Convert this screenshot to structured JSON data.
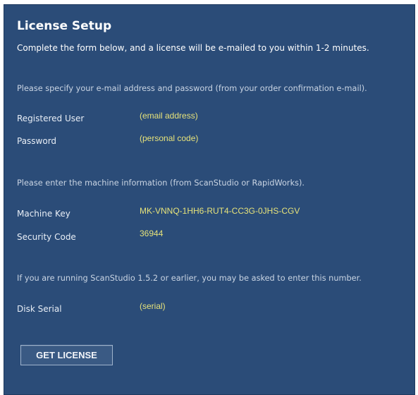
{
  "header": {
    "title": "License Setup",
    "subtitle": "Complete the form below, and a license will be e-mailed to you within 1-2 minutes."
  },
  "account_section": {
    "note": "Please specify your e-mail address and password (from your order confirmation e-mail).",
    "registered_user_label": "Registered User",
    "registered_user_value": "(email address)",
    "password_label": "Password",
    "password_value": "(personal code)"
  },
  "machine_section": {
    "note": "Please enter the machine information (from ScanStudio or RapidWorks).",
    "machine_key_label": "Machine Key",
    "machine_key_value": "MK-VNNQ-1HH6-RUT4-CC3G-0JHS-CGV",
    "security_code_label": "Security Code",
    "security_code_value": "36944"
  },
  "disk_section": {
    "note": "If you are running ScanStudio 1.5.2 or earlier, you may be asked to enter this number.",
    "disk_serial_label": "Disk Serial",
    "disk_serial_value": "(serial)"
  },
  "actions": {
    "get_license_label": "GET LICENSE"
  },
  "colors": {
    "panel_background": "#2b4c78",
    "value_text": "#e6e27a"
  }
}
